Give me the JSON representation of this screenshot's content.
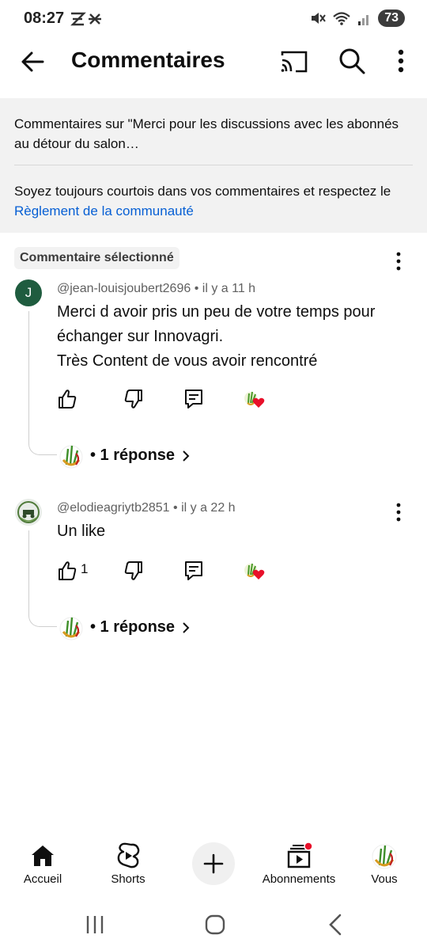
{
  "status": {
    "time": "08:27",
    "battery": "73"
  },
  "header": {
    "title": "Commentaires"
  },
  "info": {
    "context": "Commentaires sur \"Merci pour les discussions avec les abonnés au détour du salon…",
    "rules_prefix": "Soyez toujours courtois dans vos commentaires et respectez le ",
    "rules_link": "Règlement de la communauté"
  },
  "selected_label": "Commentaire sélectionné",
  "comments": [
    {
      "avatar_letter": "J",
      "author": "@jean-louisjoubert2696",
      "time": "il y a 11 h",
      "lines": [
        "Merci d avoir pris un peu de votre temps pour",
        "échanger sur Innovagri.",
        "Très Content de vous avoir rencontré"
      ],
      "likes": "",
      "replies": "• 1 réponse"
    },
    {
      "author": "@elodieagriytb2851",
      "time": "il y a 22 h",
      "lines": [
        "Un like"
      ],
      "likes": "1",
      "replies": "• 1 réponse"
    }
  ],
  "separator": "•",
  "nav": {
    "items": [
      {
        "label": "Accueil",
        "icon": "home-icon"
      },
      {
        "label": "Shorts",
        "icon": "shorts-icon"
      },
      {
        "label": "Abonnements",
        "icon": "subscriptions-icon"
      },
      {
        "label": "Vous",
        "icon": "profile-icon"
      }
    ]
  },
  "colors": {
    "link": "#065fd4",
    "avatar_j": "#1f5c3f",
    "heart": "#e8102a",
    "panel_bg": "#f2f2f2"
  }
}
